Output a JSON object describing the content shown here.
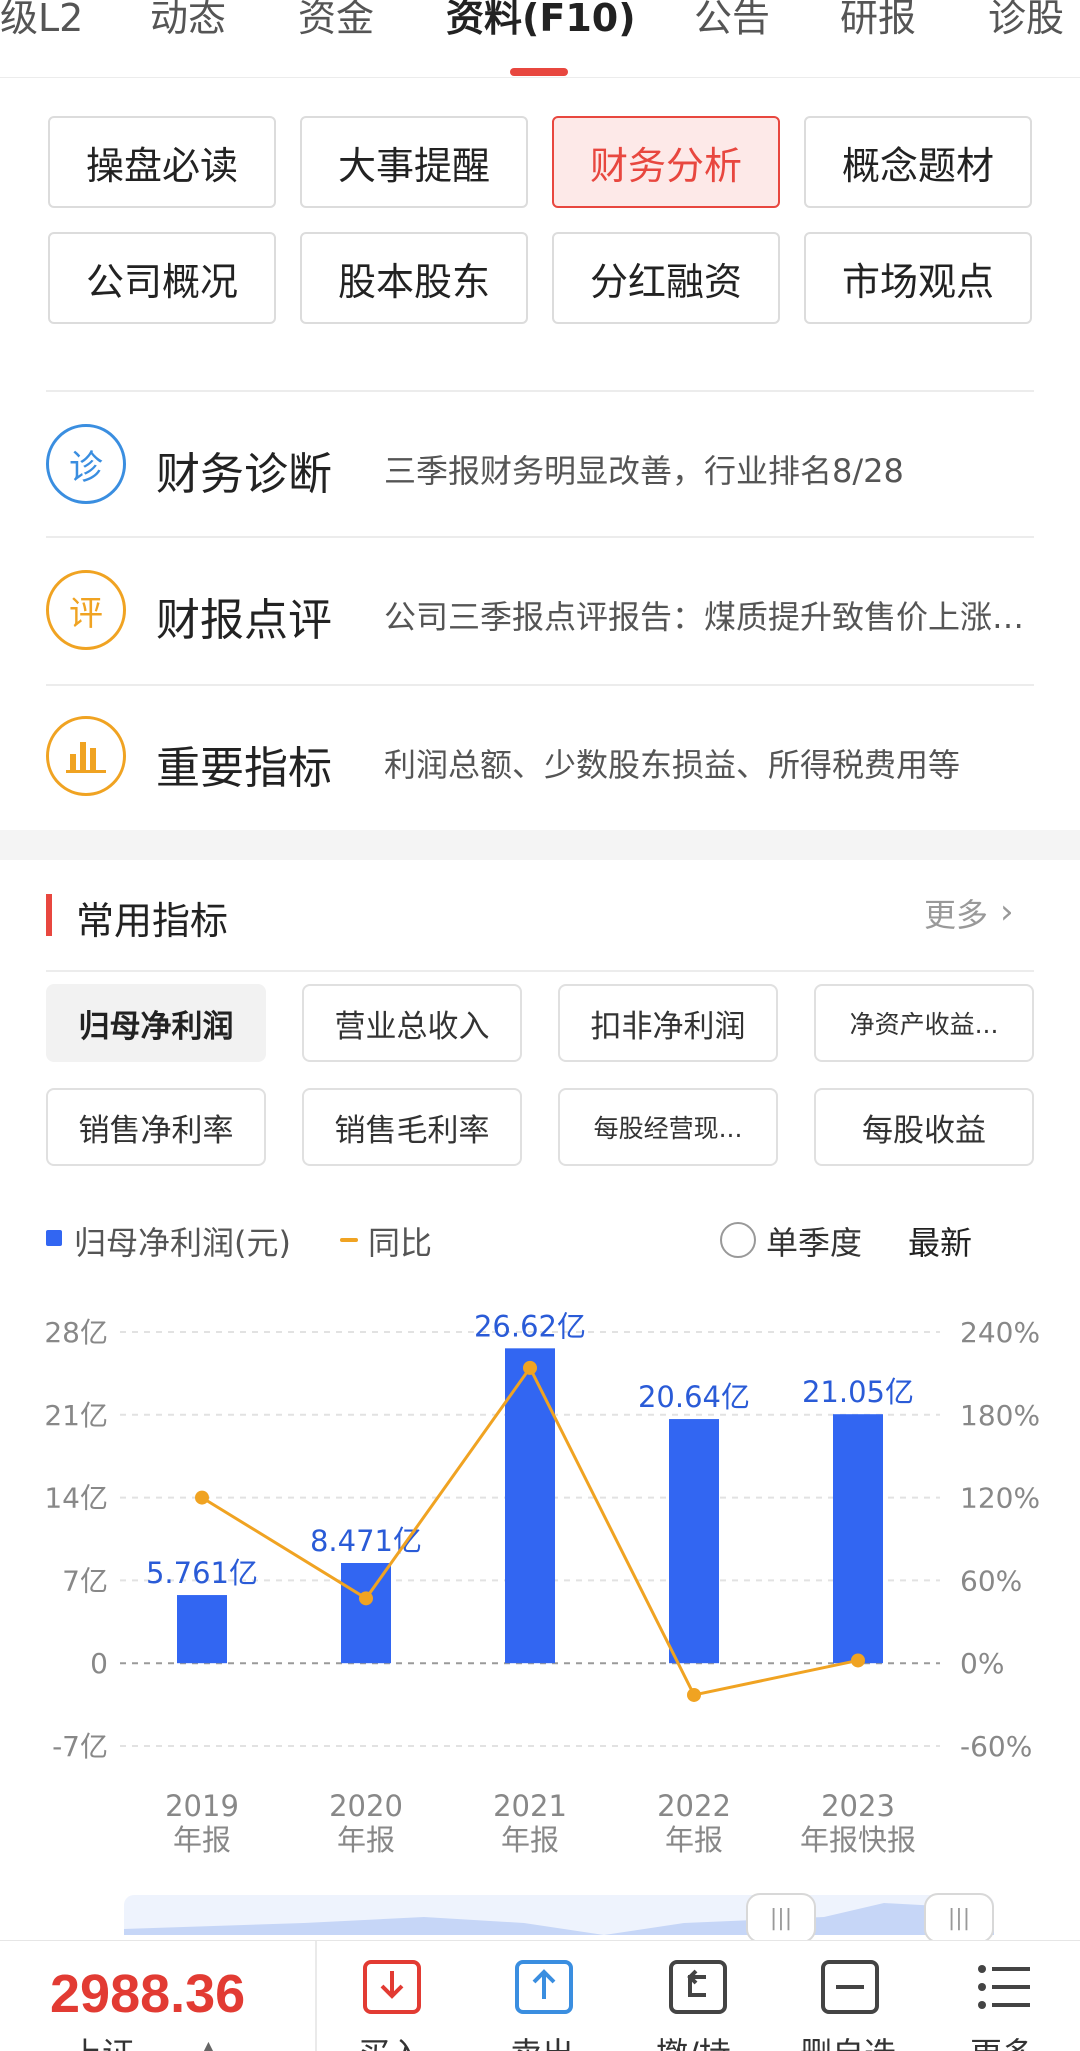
{
  "top_tabs": [
    {
      "label": "级L2",
      "active": false
    },
    {
      "label": "动态",
      "active": false
    },
    {
      "label": "资金",
      "active": false
    },
    {
      "label": "资料(F10)",
      "active": true
    },
    {
      "label": "公告",
      "active": false
    },
    {
      "label": "研报",
      "active": false
    },
    {
      "label": "诊股",
      "active": false
    }
  ],
  "categories": [
    {
      "label": "操盘必读",
      "active": false
    },
    {
      "label": "大事提醒",
      "active": false
    },
    {
      "label": "财务分析",
      "active": true
    },
    {
      "label": "概念题材",
      "active": false
    },
    {
      "label": "公司概况",
      "active": false
    },
    {
      "label": "股本股东",
      "active": false
    },
    {
      "label": "分红融资",
      "active": false
    },
    {
      "label": "市场观点",
      "active": false
    }
  ],
  "features": [
    {
      "icon_char": "诊",
      "icon": "diagnosis-icon",
      "color": "#3a8ee0",
      "title": "财务诊断",
      "desc": "三季报财务明显改善，行业排名8/28"
    },
    {
      "icon_char": "评",
      "icon": "review-icon",
      "color": "#f0a322",
      "title": "财报点评",
      "desc": "公司三季报点评报告：煤质提升致售价上涨，量价齐升带动业绩增长"
    },
    {
      "icon_char": "",
      "icon": "bar-chart-icon",
      "color": "#f0a322",
      "title": "重要指标",
      "desc": "利润总额、少数股东损益、所得税费用等"
    }
  ],
  "section": {
    "title": "常用指标",
    "more": "更多"
  },
  "indicators": [
    {
      "label": "归母净利润",
      "active": true,
      "small": false
    },
    {
      "label": "营业总收入",
      "active": false,
      "small": false
    },
    {
      "label": "扣非净利润",
      "active": false,
      "small": false
    },
    {
      "label": "净资产收益...",
      "active": false,
      "small": true
    },
    {
      "label": "销售净利率",
      "active": false,
      "small": false
    },
    {
      "label": "销售毛利率",
      "active": false,
      "small": false
    },
    {
      "label": "每股经营现...",
      "active": false,
      "small": true
    },
    {
      "label": "每股收益",
      "active": false,
      "small": false
    }
  ],
  "legend": {
    "bar_label": "归母净利润(元)",
    "line_label": "同比",
    "single_quarter": "单季度",
    "latest": "最新"
  },
  "chart_data": {
    "type": "bar",
    "categories": [
      "2019\n年报",
      "2020\n年报",
      "2021\n年报",
      "2022\n年报",
      "2023\n年报快报"
    ],
    "category_lines": [
      [
        "2019",
        "年报"
      ],
      [
        "2020",
        "年报"
      ],
      [
        "2021",
        "年报"
      ],
      [
        "2022",
        "年报"
      ],
      [
        "2023",
        "年报快报"
      ]
    ],
    "series": [
      {
        "name": "归母净利润(元)",
        "type": "bar",
        "axis": "left",
        "values": [
          5.761,
          8.471,
          26.62,
          20.64,
          21.05
        ],
        "labels": [
          "5.761亿",
          "8.471亿",
          "26.62亿",
          "20.64亿",
          "21.05亿"
        ],
        "color": "#3266f2"
      },
      {
        "name": "同比",
        "type": "line",
        "axis": "right",
        "values": [
          120,
          47,
          214,
          -23,
          2
        ],
        "color": "#f0a322"
      }
    ],
    "y_left": {
      "ticks": [
        28,
        21,
        14,
        7,
        0,
        -7
      ],
      "tick_labels": [
        "28亿",
        "21亿",
        "14亿",
        "7亿",
        "0",
        "-7亿"
      ],
      "range": [
        -7,
        28
      ]
    },
    "y_right": {
      "ticks": [
        240,
        180,
        120,
        60,
        0,
        -60
      ],
      "tick_labels": [
        "240%",
        "180%",
        "120%",
        "60%",
        "0%",
        "-60%"
      ],
      "range": [
        -60,
        240
      ]
    },
    "grid": true
  },
  "bottom": {
    "index_value": "2988.36",
    "index_name": "上证",
    "actions": [
      {
        "label": "买入",
        "icon": "buy-icon",
        "color": "#e23b33"
      },
      {
        "label": "卖出",
        "icon": "sell-icon",
        "color": "#3a8ee0"
      },
      {
        "label": "撤/持",
        "icon": "cancel-hold-icon",
        "color": "#444"
      },
      {
        "label": "删自选",
        "icon": "remove-watchlist-icon",
        "color": "#444"
      },
      {
        "label": "更多",
        "icon": "menu-icon",
        "color": "#444"
      }
    ]
  }
}
